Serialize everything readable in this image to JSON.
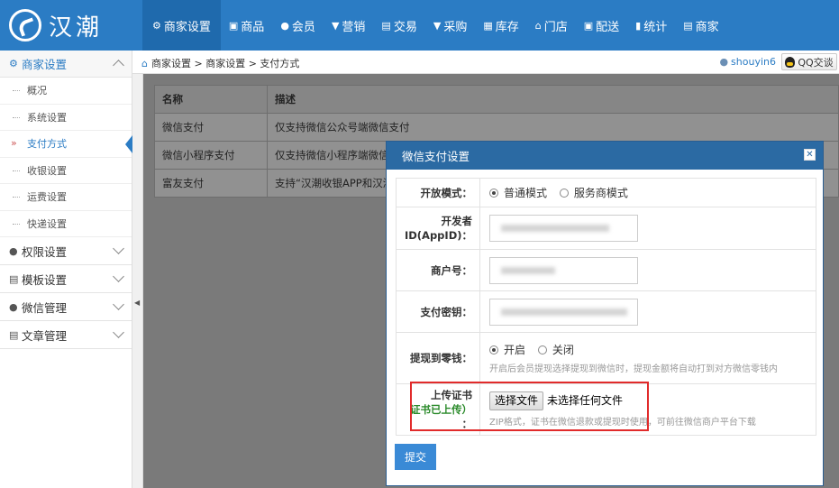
{
  "app": {
    "logo_text": "汉潮"
  },
  "topnav": [
    {
      "label": "商家设置",
      "icon": "gear-icon",
      "glyph": "⚙",
      "active": true
    },
    {
      "label": "商品",
      "icon": "goods-icon",
      "glyph": "▣",
      "active": false
    },
    {
      "label": "会员",
      "icon": "user-icon",
      "glyph": "●",
      "active": false
    },
    {
      "label": "营销",
      "icon": "marketing-icon",
      "glyph": "▼",
      "active": false
    },
    {
      "label": "交易",
      "icon": "trade-icon",
      "glyph": "▤",
      "active": false
    },
    {
      "label": "采购",
      "icon": "purchase-icon",
      "glyph": "▼",
      "active": false
    },
    {
      "label": "库存",
      "icon": "stock-icon",
      "glyph": "▦",
      "active": false
    },
    {
      "label": "门店",
      "icon": "store-icon",
      "glyph": "⌂",
      "active": false
    },
    {
      "label": "配送",
      "icon": "delivery-icon",
      "glyph": "▣",
      "active": false
    },
    {
      "label": "统计",
      "icon": "stats-icon",
      "glyph": "▮",
      "active": false
    },
    {
      "label": "商家",
      "icon": "merchant-icon",
      "glyph": "▤",
      "active": false
    }
  ],
  "sidebar": {
    "groups": [
      {
        "label": "商家设置",
        "icon": "gear-icon",
        "glyph": "⚙",
        "open": true
      },
      {
        "label": "权限设置",
        "icon": "key-icon",
        "glyph": "●"
      },
      {
        "label": "模板设置",
        "icon": "template-icon",
        "glyph": "▤"
      },
      {
        "label": "微信管理",
        "icon": "wechat-icon",
        "glyph": "●"
      },
      {
        "label": "文章管理",
        "icon": "article-icon",
        "glyph": "▤"
      }
    ],
    "subitems": [
      "概况",
      "系统设置",
      "支付方式",
      "收银设置",
      "运费设置",
      "快递设置"
    ],
    "active_subitem": "支付方式"
  },
  "breadcrumb": {
    "text": "商家设置 > 商家设置 > 支付方式"
  },
  "user": {
    "name": "shouyin6",
    "qq_label": "QQ交谈"
  },
  "payment_table": {
    "headers": [
      "名称",
      "描述"
    ],
    "rows": [
      [
        "微信支付",
        "仅支持微信公众号端微信支付"
      ],
      [
        "微信小程序支付",
        "仅支持微信小程序端微信"
      ],
      [
        "富友支付",
        "支持“汉潮收银APP和汉湖"
      ]
    ]
  },
  "modal": {
    "title": "微信支付设置",
    "close_label": "✕",
    "fields": {
      "mode": {
        "label": "开放模式：",
        "options": [
          "普通模式",
          "服务商模式"
        ],
        "selected": "普通模式"
      },
      "appid": {
        "label_line1": "开发者",
        "label_line2": "ID(AppID)："
      },
      "mchid": {
        "label": "商户号："
      },
      "paykey": {
        "label": "支付密钥："
      },
      "change": {
        "label": "提现到零钱：",
        "options": [
          "开启",
          "关闭"
        ],
        "selected": "开启",
        "hint": "开启后会员提现选择提现到微信时，提现金额将自动打到对方微信零钱内"
      },
      "cert": {
        "label_line1": "上传证书",
        "label_line2": "证书已上传）",
        "label_line3": "：",
        "button": "选择文件",
        "status": "未选择任何文件",
        "hint": "ZIP格式，证书在微信退款或提现时使用，可前往微信商户平台下载"
      }
    },
    "submit_label": "提交"
  },
  "colors": {
    "primary": "#2b7cc4",
    "highlight_box": "#e12b2b",
    "cert_uploaded": "#2a8a2a"
  }
}
